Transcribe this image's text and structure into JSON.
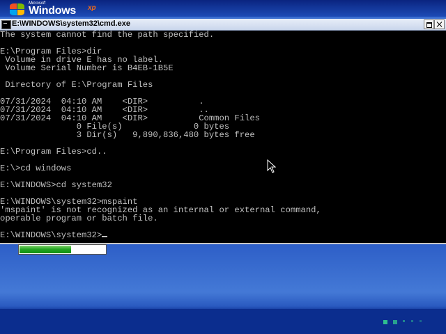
{
  "branding": {
    "microsoft": "Microsoft",
    "windows": "Windows",
    "xp": "xp"
  },
  "window": {
    "title": "E:\\WINDOWS\\system32\\cmd.exe",
    "icon": "console-icon"
  },
  "console": {
    "lines": [
      "The system cannot find the path specified.",
      "",
      "E:\\Program Files>dir",
      " Volume in drive E has no label.",
      " Volume Serial Number is B4EB-1B5E",
      "",
      " Directory of E:\\Program Files",
      "",
      "07/31/2024  04:10 AM    <DIR>          .",
      "07/31/2024  04:10 AM    <DIR>          ..",
      "07/31/2024  04:10 AM    <DIR>          Common Files",
      "               0 File(s)              0 bytes",
      "               3 Dir(s)   9,890,836,480 bytes free",
      "",
      "E:\\Program Files>cd..",
      "",
      "E:\\>cd windows",
      "",
      "E:\\WINDOWS>cd system32",
      "",
      "E:\\WINDOWS\\system32>mspaint",
      "'mspaint' is not recognized as an internal or external command,",
      "operable program or batch file.",
      "",
      "E:\\WINDOWS\\system32>"
    ],
    "text_color": "#c0c0c0",
    "background": "#000000"
  },
  "progress": {
    "fraction": 0.6,
    "color": "#22a322"
  },
  "icons": {
    "restore": "restore-icon",
    "close": "close-icon",
    "pointer": "mouse-pointer-icon",
    "flag": "windows-flag-icon"
  }
}
